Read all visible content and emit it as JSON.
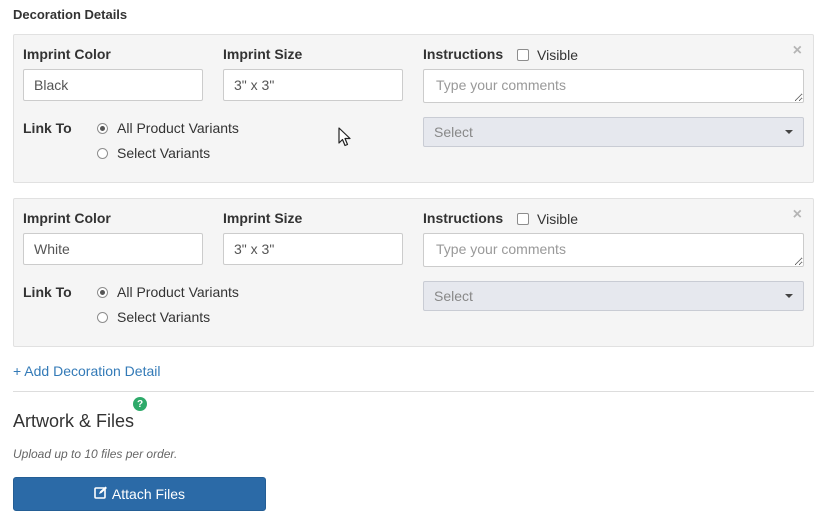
{
  "section_title": "Decoration Details",
  "decorations": [
    {
      "imprint_color_label": "Imprint Color",
      "imprint_color_value": "Black",
      "imprint_size_label": "Imprint Size",
      "imprint_size_value": "3\" x 3\"",
      "instructions_label": "Instructions",
      "visible_label": "Visible",
      "comments_placeholder": "Type your comments",
      "close_symbol": "×",
      "link_to_label": "Link To",
      "radio_all": "All Product Variants",
      "radio_select": "Select Variants",
      "select_value": "Select"
    },
    {
      "imprint_color_label": "Imprint Color",
      "imprint_color_value": "White",
      "imprint_size_label": "Imprint Size",
      "imprint_size_value": "3\" x 3\"",
      "instructions_label": "Instructions",
      "visible_label": "Visible",
      "comments_placeholder": "Type your comments",
      "close_symbol": "×",
      "link_to_label": "Link To",
      "radio_all": "All Product Variants",
      "radio_select": "Select Variants",
      "select_value": "Select"
    }
  ],
  "add_decoration_link": "+ Add Decoration Detail",
  "artwork": {
    "title": "Artwork & Files",
    "help_symbol": "?",
    "upload_note": "Upload up to 10 files per order.",
    "attach_button": "Attach Files"
  },
  "colors": {
    "link": "#337ab7",
    "primary_button": "#2b6aa7",
    "help_icon": "#2eaa6a",
    "panel_bg": "#f5f5f5"
  },
  "icons": {
    "close": "close-icon",
    "caret": "chevron-down-icon",
    "help": "help-icon",
    "attach": "edit-icon",
    "cursor": "mouse-pointer-icon"
  }
}
